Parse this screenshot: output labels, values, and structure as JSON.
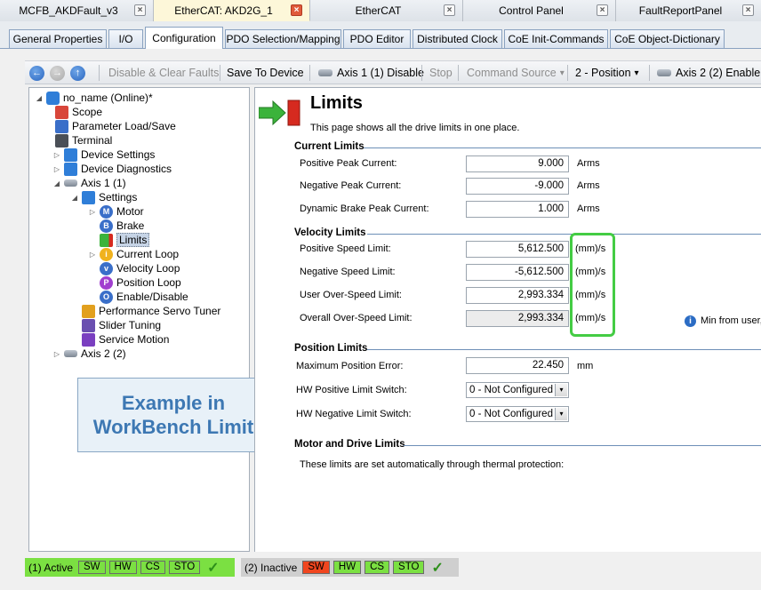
{
  "doc_tabs": [
    {
      "label": "MCFB_AKDFault_v3",
      "active": false
    },
    {
      "label": "EtherCAT: AKD2G_1",
      "active": true
    },
    {
      "label": "EtherCAT",
      "active": false
    },
    {
      "label": "Control Panel",
      "active": false
    },
    {
      "label": "FaultReportPanel",
      "active": false
    }
  ],
  "close_glyph": "×",
  "sub_tabs": [
    "General Properties",
    "I/O",
    "Configuration",
    "PDO Selection/Mapping",
    "PDO Editor",
    "Distributed Clock",
    "CoE Init-Commands",
    "CoE Object-Dictionary"
  ],
  "active_sub_tab": "Configuration",
  "toolbar": {
    "back_glyph": "←",
    "forward_glyph": "→",
    "up_glyph": "↑",
    "disable_clear_faults": "Disable & Clear Faults",
    "save_to_device": "Save To Device",
    "axis1_disable": "Axis 1 (1) Disable",
    "stop": "Stop",
    "command_source": "Command Source",
    "position_mode": "2 - Position",
    "axis2_enable": "Axis 2 (2) Enable",
    "dropdown_glyph": "▾"
  },
  "tree": {
    "root": "no_name (Online)*",
    "items": {
      "scope": "Scope",
      "param": "Parameter Load/Save",
      "terminal": "Terminal",
      "device_settings": "Device Settings",
      "device_diag": "Device Diagnostics",
      "axis1": "Axis 1 (1)",
      "settings": "Settings",
      "motor": "Motor",
      "brake": "Brake",
      "limits": "Limits",
      "current_loop": "Current Loop",
      "velocity_loop": "Velocity Loop",
      "position_loop": "Position Loop",
      "enable_disable": "Enable/Disable",
      "perf_tuner": "Performance Servo Tuner",
      "slider": "Slider Tuning",
      "service_motion": "Service Motion",
      "axis2": "Axis 2 (2)"
    },
    "expand_open": "◢",
    "expand_closed": "▷"
  },
  "callout": {
    "line1": "Example in",
    "line2": "WorkBench Limit"
  },
  "page": {
    "title": "Limits",
    "subtitle": "This page shows all the drive limits in one place."
  },
  "current_limits": {
    "heading": "Current Limits",
    "rows": [
      {
        "label": "Positive Peak Current:",
        "value": "9.000",
        "unit": "Arms"
      },
      {
        "label": "Negative Peak Current:",
        "value": "-9.000",
        "unit": "Arms"
      },
      {
        "label": "Dynamic Brake Peak Current:",
        "value": "1.000",
        "unit": "Arms"
      }
    ]
  },
  "velocity_limits": {
    "heading": "Velocity Limits",
    "rows": [
      {
        "label": "Positive Speed Limit:",
        "value": "5,612.500",
        "unit": "(mm)/s"
      },
      {
        "label": "Negative Speed Limit:",
        "value": "-5,612.500",
        "unit": "(mm)/s"
      },
      {
        "label": "User Over-Speed Limit:",
        "value": "2,993.334",
        "unit": "(mm)/s"
      },
      {
        "label": "Overall Over-Speed Limit:",
        "value": "2,993.334",
        "unit": "(mm)/s"
      }
    ],
    "info_glyph": "i",
    "info_note": "Min from user, r"
  },
  "position_limits": {
    "heading": "Position Limits",
    "max_error_label": "Maximum Position Error:",
    "max_error_value": "22.450",
    "max_error_unit": "mm",
    "hw_pos_label": "HW Positive Limit Switch:",
    "hw_pos_value": "0 - Not Configured",
    "hw_neg_label": "HW Negative Limit Switch:",
    "hw_neg_value": "0 - Not Configured"
  },
  "motor_drive_limits": {
    "heading": "Motor and Drive Limits",
    "text": "These limits are set automatically through thermal protection:"
  },
  "status": {
    "axis1": {
      "label": "(1) Active",
      "chips": [
        "SW",
        "HW",
        "CS",
        "STO"
      ]
    },
    "axis2": {
      "label": "(2) Inactive",
      "chips": [
        "SW",
        "HW",
        "CS",
        "STO"
      ]
    },
    "check_glyph": "✓"
  },
  "colors": {
    "active_green": "#7be042",
    "fault_red": "#f0461f",
    "highlight_green": "#44cc44",
    "callout_text": "#3d78b3"
  }
}
